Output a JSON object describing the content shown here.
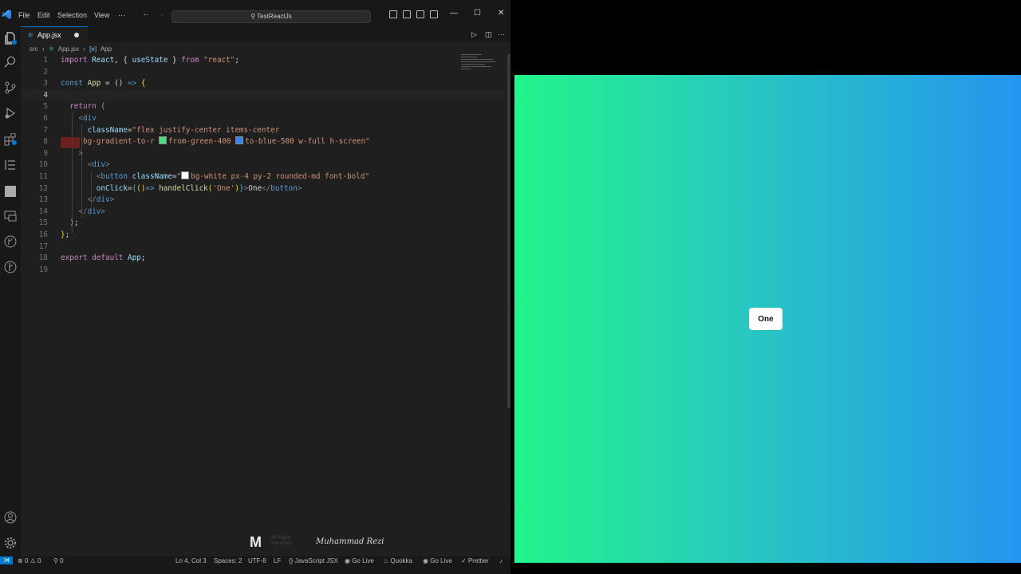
{
  "titlebar": {
    "menu": [
      "File",
      "Edit",
      "Selection",
      "View",
      "···"
    ],
    "search_text": "TestReactJs"
  },
  "tab": {
    "name": "App.jsx"
  },
  "breadcrumb": {
    "folder": "src",
    "file": "App.jsx",
    "symbol": "App"
  },
  "editor": {
    "line_numbers": [
      "1",
      "2",
      "3",
      "4",
      "5",
      "6",
      "7",
      "8",
      "9",
      "10",
      "11",
      "12",
      "13",
      "14",
      "15",
      "16",
      "17",
      "18",
      "19"
    ],
    "current_line": "4"
  },
  "statusbar": {
    "errors": "0",
    "warnings": "0",
    "ports": "0",
    "position": "Ln 4, Col 3",
    "spaces": "Spaces: 2",
    "encoding": "UTF-8",
    "eol": "LF",
    "language": "JavaScript JSX",
    "golive1": "Go Live",
    "quokka": "Quokka",
    "golive2": "Go Live",
    "prettier": "Prettier"
  },
  "watermark": {
    "logo": "M",
    "rights": "All Rights Reserved",
    "signature": "Muhammad Rezi"
  },
  "preview": {
    "button_label": "One"
  },
  "colors": {
    "accent": "#0078d4",
    "gradient_from": "#22f58a",
    "gradient_to": "#2595f0"
  }
}
